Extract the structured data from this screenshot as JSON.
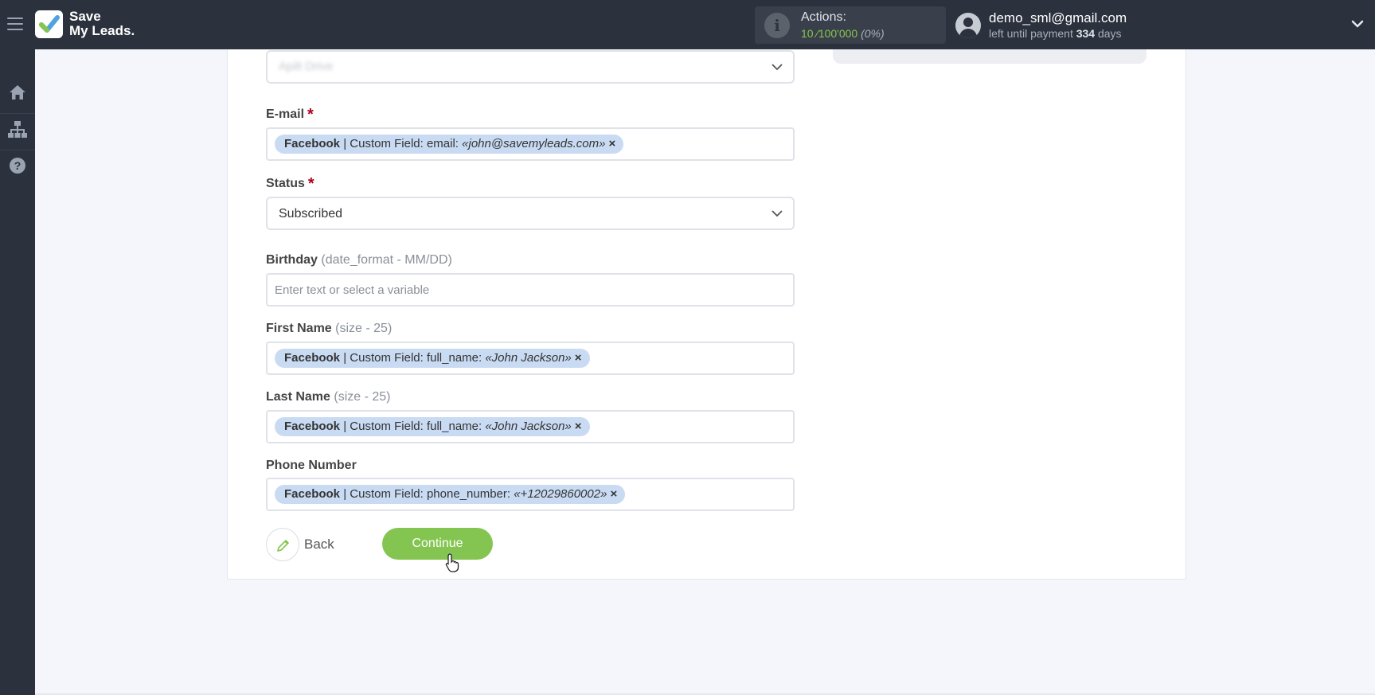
{
  "header": {
    "logo_line1": "Save",
    "logo_line2": "My Leads.",
    "actions_label": "Actions:",
    "actions_used": "10",
    "actions_sep": "⁄",
    "actions_total": "100'000",
    "actions_pct": "(0%)",
    "user_email": "demo_sml@gmail.com",
    "payment_prefix": "left until payment",
    "payment_days": "334",
    "payment_suffix": "days"
  },
  "sidebar": {
    "items": [
      {
        "icon": "home-icon"
      },
      {
        "icon": "sitemap-icon"
      },
      {
        "icon": "help-icon"
      }
    ]
  },
  "form": {
    "top_select_value": "Apilt Drive",
    "email": {
      "label": "E-mail",
      "required": "*",
      "tag_source": "Facebook",
      "tag_text": " | Custom Field: email: ",
      "tag_value": "«john@savemyleads.com»",
      "remove": "×"
    },
    "status": {
      "label": "Status",
      "required": "*",
      "value": "Subscribed"
    },
    "birthday": {
      "label": "Birthday",
      "hint": "(date_format - MM/DD)",
      "placeholder": "Enter text or select a variable"
    },
    "first_name": {
      "label": "First Name",
      "hint": "(size - 25)",
      "tag_source": "Facebook",
      "tag_text": " | Custom Field: full_name: ",
      "tag_value": "«John Jackson»",
      "remove": "×"
    },
    "last_name": {
      "label": "Last Name",
      "hint": "(size - 25)",
      "tag_source": "Facebook",
      "tag_text": " | Custom Field: full_name: ",
      "tag_value": "«John Jackson»",
      "remove": "×"
    },
    "phone": {
      "label": "Phone Number",
      "tag_source": "Facebook",
      "tag_text": " | Custom Field: phone_number: ",
      "tag_value": "«+12029860002»",
      "remove": "×"
    },
    "back_label": "Back",
    "continue_label": "Continue"
  },
  "colors": {
    "topbar": "#2b313d",
    "accent_green": "#84c552",
    "tag_blue": "#c9dbf3",
    "required_red": "#b0001c"
  }
}
